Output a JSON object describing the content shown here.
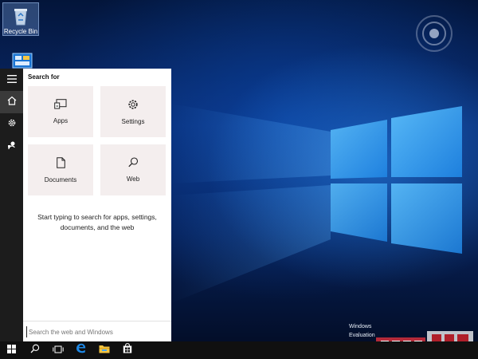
{
  "desktop": {
    "icons": [
      {
        "label": "Recycle Bin",
        "icon": "recycle-bin-icon"
      },
      {
        "label": "",
        "icon": "shortcut-icon"
      }
    ],
    "evaluation": {
      "line1": "Windows",
      "line2": "Evaluation"
    }
  },
  "rail": {
    "items": [
      {
        "icon": "hamburger-menu-icon"
      },
      {
        "icon": "home-icon"
      },
      {
        "icon": "settings-gear-icon"
      },
      {
        "icon": "feedback-icon"
      }
    ]
  },
  "search_panel": {
    "title": "Search for",
    "tiles": [
      {
        "label": "Apps",
        "icon": "apps-icon"
      },
      {
        "label": "Settings",
        "icon": "gear-icon"
      },
      {
        "label": "Documents",
        "icon": "document-icon"
      },
      {
        "label": "Web",
        "icon": "magnifier-icon"
      }
    ],
    "hint": "Start typing to search for apps, settings, documents, and the web",
    "search_box": {
      "value": "",
      "placeholder": "Search the web and Windows"
    }
  },
  "taskbar": {
    "items": [
      {
        "icon": "windows-start-icon"
      },
      {
        "icon": "search-icon"
      },
      {
        "icon": "task-view-icon"
      },
      {
        "icon": "edge-browser-icon"
      },
      {
        "icon": "file-explorer-icon"
      },
      {
        "icon": "store-icon"
      }
    ]
  },
  "colors": {
    "taskbar": "#101010",
    "rail": "#1c1c1c",
    "tile": "#f4eeee",
    "edge_blue": "#1e88e5",
    "explorer_yellow": "#f5c542",
    "watermark_red": "#d22f3c"
  }
}
